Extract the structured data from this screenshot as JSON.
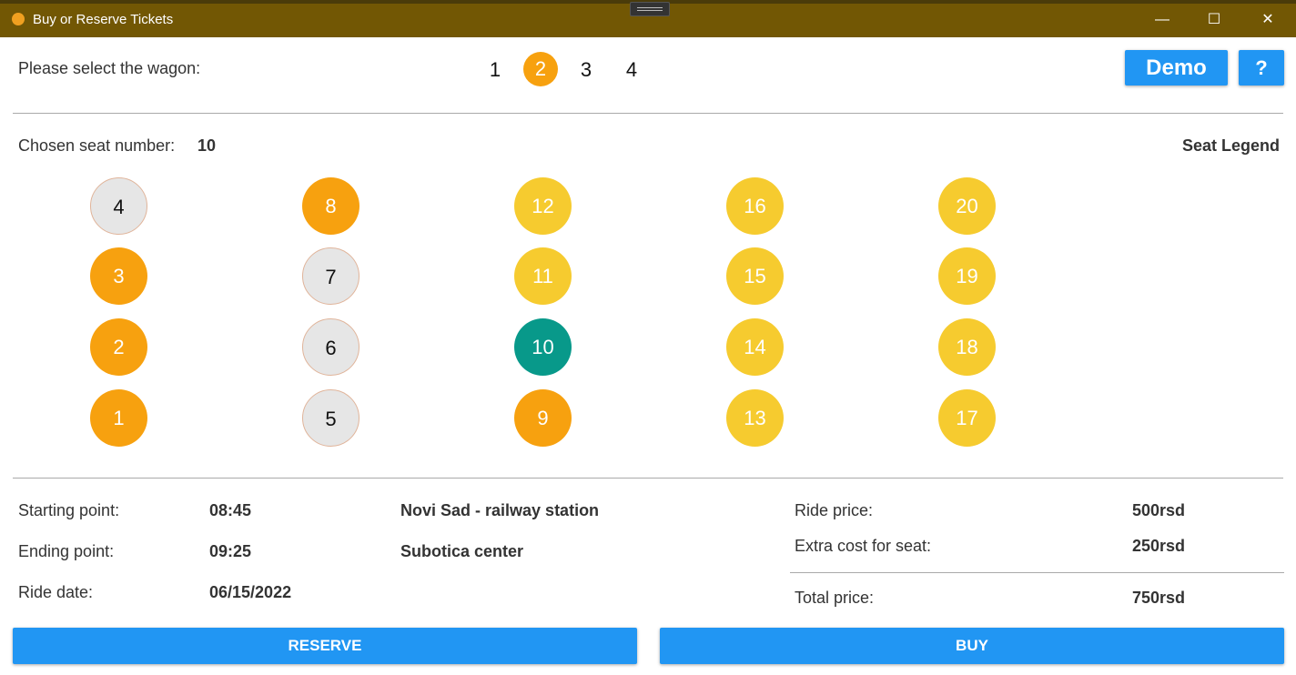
{
  "window": {
    "title": "Buy or Reserve Tickets",
    "minimize": "—",
    "maximize": "☐",
    "close": "✕"
  },
  "wagon_select": {
    "label": "Please select the wagon:",
    "wagons": [
      "1",
      "2",
      "3",
      "4"
    ],
    "selected": "2"
  },
  "toolbar": {
    "demo_label": "Demo",
    "help_label": "?"
  },
  "seat_panel": {
    "chosen_label": "Chosen seat number:",
    "chosen_value": "10",
    "legend_label": "Seat Legend",
    "colors": {
      "free": "#e6e6e6",
      "orange": "#f7a10f",
      "yellow": "#f6cb2f",
      "chosen": "#08998a"
    },
    "columns": [
      [
        {
          "n": "4",
          "state": "free"
        },
        {
          "n": "3",
          "state": "orange"
        },
        {
          "n": "2",
          "state": "orange"
        },
        {
          "n": "1",
          "state": "orange"
        }
      ],
      [
        {
          "n": "8",
          "state": "orange"
        },
        {
          "n": "7",
          "state": "free"
        },
        {
          "n": "6",
          "state": "free"
        },
        {
          "n": "5",
          "state": "free"
        }
      ],
      [
        {
          "n": "12",
          "state": "yellow"
        },
        {
          "n": "11",
          "state": "yellow"
        },
        {
          "n": "10",
          "state": "chosen"
        },
        {
          "n": "9",
          "state": "orange"
        }
      ],
      [
        {
          "n": "16",
          "state": "yellow"
        },
        {
          "n": "15",
          "state": "yellow"
        },
        {
          "n": "14",
          "state": "yellow"
        },
        {
          "n": "13",
          "state": "yellow"
        }
      ],
      [
        {
          "n": "20",
          "state": "yellow"
        },
        {
          "n": "19",
          "state": "yellow"
        },
        {
          "n": "18",
          "state": "yellow"
        },
        {
          "n": "17",
          "state": "yellow"
        }
      ]
    ]
  },
  "ride": {
    "start_label": "Starting point:",
    "start_time": "08:45",
    "start_place": "Novi Sad - railway station",
    "end_label": "Ending point:",
    "end_time": "09:25",
    "end_place": "Subotica center",
    "date_label": "Ride date:",
    "date_value": "06/15/2022"
  },
  "pricing": {
    "ride_price_label": "Ride price:",
    "ride_price_value": "500rsd",
    "extra_label": "Extra cost for seat:",
    "extra_value": "250rsd",
    "total_label": "Total price:",
    "total_value": "750rsd"
  },
  "actions": {
    "reserve_label": "RESERVE",
    "buy_label": "BUY"
  }
}
